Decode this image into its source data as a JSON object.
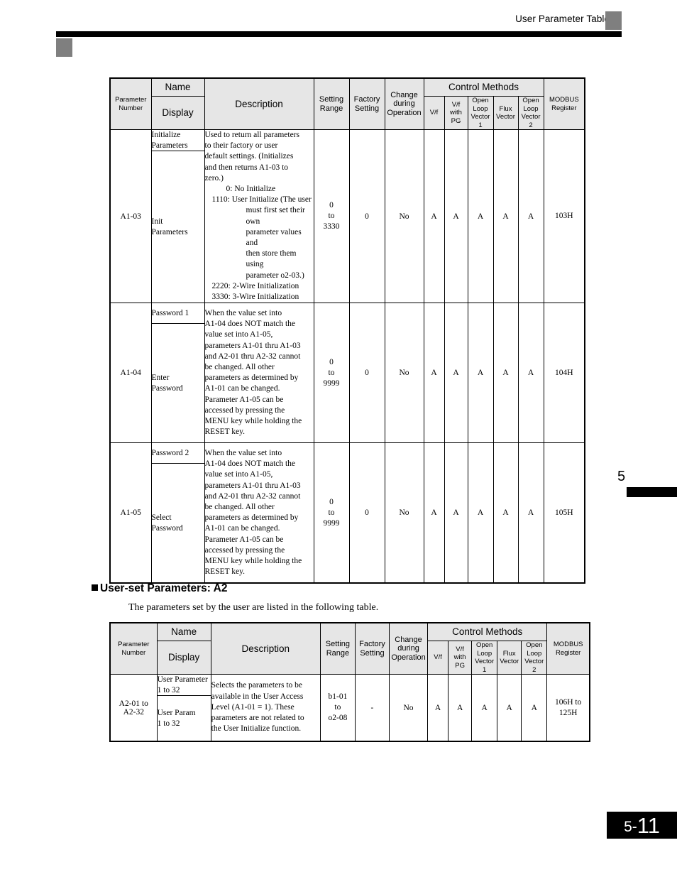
{
  "header": {
    "title": "User Parameter Tables"
  },
  "chapter_tab": {
    "number": "5"
  },
  "footer": {
    "chapter": "5-",
    "page": "11"
  },
  "table_headers": {
    "parameter_number": "Parameter\nNumber",
    "name": "Name",
    "display": "Display",
    "description": "Description",
    "setting_range": "Setting\nRange",
    "factory_setting": "Factory\nSetting",
    "change_during_operation": "Change\nduring\nOperation",
    "control_methods": "Control Methods",
    "ctl_vf": "V/f",
    "ctl_vf_with_pg": "V/f\nwith\nPG",
    "ctl_open_loop_vector_1": "Open\nLoop\nVector\n1",
    "ctl_flux_vector": "Flux\nVector",
    "ctl_open_loop_vector_2": "Open\nLoop\nVector\n2",
    "modbus_register": "MODBUS\nRegister"
  },
  "table_a1": {
    "rows": [
      {
        "parameter_number": "A1-03",
        "name_upper": "Initialize\nParameters",
        "name_lower": "Init\nParameters",
        "description_lines": [
          {
            "text": "Used to return all parameters",
            "indent": 0
          },
          {
            "text": "to their factory or user",
            "indent": 0
          },
          {
            "text": "default settings. (Initializes",
            "indent": 0
          },
          {
            "text": "and then returns A1-03 to",
            "indent": 0
          },
          {
            "text": "zero.)",
            "indent": 0
          },
          {
            "text": "0: No Initialize",
            "indent": 1
          },
          {
            "text": "1110: User Initialize (The user",
            "indent": 2
          },
          {
            "text": "must first set their own",
            "indent": 3
          },
          {
            "text": "parameter values and",
            "indent": 3
          },
          {
            "text": "then store them using",
            "indent": 3
          },
          {
            "text": "parameter o2-03.)",
            "indent": 3
          },
          {
            "text": "2220: 2-Wire Initialization",
            "indent": 2
          },
          {
            "text": "3330: 3-Wire Initialization",
            "indent": 2
          }
        ],
        "setting_range": "0\nto\n3330",
        "factory_setting": "0",
        "change_during_operation": "No",
        "ctl_vf": "A",
        "ctl_vf_with_pg": "A",
        "ctl_open_loop_vector_1": "A",
        "ctl_flux_vector": "A",
        "ctl_open_loop_vector_2": "A",
        "modbus_register": "103H"
      },
      {
        "parameter_number": "A1-04",
        "name_upper": "Password 1",
        "name_lower": "Enter\nPassword",
        "description_lines": [
          {
            "text": "When the value set into",
            "indent": 0
          },
          {
            "text": "A1-04 does NOT match the",
            "indent": 0
          },
          {
            "text": "value set into A1-05,",
            "indent": 0
          },
          {
            "text": "parameters A1-01 thru A1-03",
            "indent": 0
          },
          {
            "text": "and A2-01 thru A2-32 cannot",
            "indent": 0
          },
          {
            "text": "be changed. All other",
            "indent": 0
          },
          {
            "text": "parameters as determined by",
            "indent": 0
          },
          {
            "text": "A1-01 can be changed.",
            "indent": 0
          },
          {
            "text": "Parameter A1-05 can be",
            "indent": 0
          },
          {
            "text": "accessed by pressing the",
            "indent": 0
          },
          {
            "text": "MENU key while holding the",
            "indent": 0
          },
          {
            "text": "RESET key.",
            "indent": 0
          }
        ],
        "setting_range": "0\nto\n9999",
        "factory_setting": "0",
        "change_during_operation": "No",
        "ctl_vf": "A",
        "ctl_vf_with_pg": "A",
        "ctl_open_loop_vector_1": "A",
        "ctl_flux_vector": "A",
        "ctl_open_loop_vector_2": "A",
        "modbus_register": "104H"
      },
      {
        "parameter_number": "A1-05",
        "name_upper": "Password 2",
        "name_lower": "Select\nPassword",
        "description_lines": [
          {
            "text": "When the value set into",
            "indent": 0
          },
          {
            "text": "A1-04 does NOT match the",
            "indent": 0
          },
          {
            "text": "value set into A1-05,",
            "indent": 0
          },
          {
            "text": "parameters A1-01 thru A1-03",
            "indent": 0
          },
          {
            "text": "and A2-01 thru A2-32 cannot",
            "indent": 0
          },
          {
            "text": "be changed. All other",
            "indent": 0
          },
          {
            "text": "parameters as determined by",
            "indent": 0
          },
          {
            "text": "A1-01 can be changed.",
            "indent": 0
          },
          {
            "text": "Parameter A1-05 can be",
            "indent": 0
          },
          {
            "text": "accessed by pressing the",
            "indent": 0
          },
          {
            "text": "MENU key while holding the",
            "indent": 0
          },
          {
            "text": "RESET key.",
            "indent": 0
          }
        ],
        "setting_range": "0\nto\n9999",
        "factory_setting": "0",
        "change_during_operation": "No",
        "ctl_vf": "A",
        "ctl_vf_with_pg": "A",
        "ctl_open_loop_vector_1": "A",
        "ctl_flux_vector": "A",
        "ctl_open_loop_vector_2": "A",
        "modbus_register": "105H"
      }
    ]
  },
  "section_a2": {
    "heading": "User-set Parameters: A2",
    "body": "The parameters set by the user are listed in the following table."
  },
  "table_a2": {
    "rows": [
      {
        "parameter_number": "A2-01 to\nA2-32",
        "name_upper": "User Parameter\n1 to 32",
        "name_lower": "User Param\n1 to 32",
        "description_lines": [
          {
            "text": "Selects the parameters to be",
            "indent": 0
          },
          {
            "text": "available in the User Access",
            "indent": 0
          },
          {
            "text": "Level (A1-01 = 1). These",
            "indent": 0
          },
          {
            "text": "parameters are not related to",
            "indent": 0
          },
          {
            "text": "the User Initialize function.",
            "indent": 0
          }
        ],
        "setting_range": "b1-01\nto\no2-08",
        "factory_setting": "-",
        "change_during_operation": "No",
        "ctl_vf": "A",
        "ctl_vf_with_pg": "A",
        "ctl_open_loop_vector_1": "A",
        "ctl_flux_vector": "A",
        "ctl_open_loop_vector_2": "A",
        "modbus_register": "106H to\n125H"
      }
    ]
  }
}
